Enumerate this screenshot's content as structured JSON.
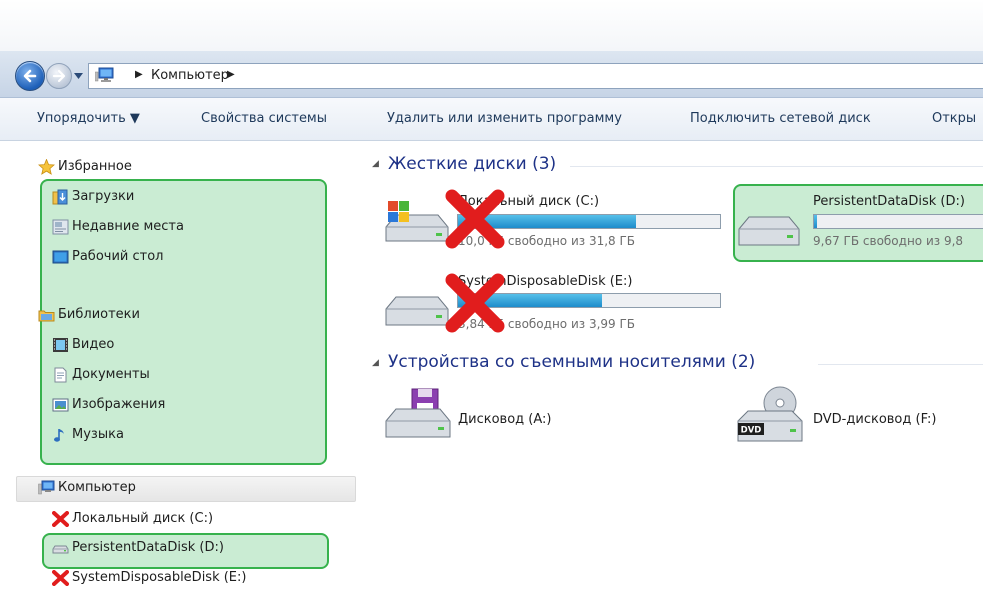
{
  "window": {
    "address": {
      "path": [
        "Компьютер"
      ]
    }
  },
  "toolbar": {
    "organize": "Упорядочить ▼",
    "system_properties": "Свойства системы",
    "uninstall": "Удалить или изменить программу",
    "map_drive": "Подключить сетевой диск",
    "open_control_panel": "Откры"
  },
  "sidebar": {
    "favorites": {
      "label": "Избранное",
      "items": [
        {
          "label": "Загрузки",
          "icon": "downloads-icon"
        },
        {
          "label": "Недавние места",
          "icon": "recent-places-icon"
        },
        {
          "label": "Рабочий стол",
          "icon": "desktop-icon"
        }
      ]
    },
    "libraries": {
      "label": "Библиотеки",
      "items": [
        {
          "label": "Видео",
          "icon": "video-icon"
        },
        {
          "label": "Документы",
          "icon": "documents-icon"
        },
        {
          "label": "Изображения",
          "icon": "images-icon"
        },
        {
          "label": "Музыка",
          "icon": "music-icon"
        }
      ]
    },
    "computer": {
      "label": "Компьютер",
      "items": [
        {
          "label": "Локальный диск (C:)",
          "icon": "drive-icon",
          "crossed": true
        },
        {
          "label": "PersistentDataDisk (D:)",
          "icon": "drive-icon",
          "highlighted": true
        },
        {
          "label": "SystemDisposableDisk (E:)",
          "icon": "drive-icon",
          "crossed": true
        }
      ]
    }
  },
  "content": {
    "hard_disks": {
      "header": "Жесткие диски (3)",
      "drives": [
        {
          "name": "Локальный диск (C:)",
          "free": "10,0 ГБ свободно из 31,8 ГБ",
          "used_fraction": 0.68,
          "crossed": true
        },
        {
          "name": "PersistentDataDisk (D:)",
          "free": "9,67 ГБ свободно из 9,8",
          "used_fraction": 0.02,
          "highlighted": true
        },
        {
          "name": "SystemDisposableDisk (E:)",
          "free": "3,84 ГБ свободно из 3,99 ГБ",
          "used_fraction": 0.55,
          "crossed": true
        }
      ]
    },
    "removable": {
      "header": "Устройства со съемными носителями (2)",
      "devices": [
        {
          "name": "Дисковод (A:)",
          "icon": "floppy-drive-icon"
        },
        {
          "name": "DVD-дисковод (F:)",
          "icon": "dvd-drive-icon",
          "badge": "DVD"
        }
      ]
    }
  },
  "colors": {
    "highlight_border": "#37b24d",
    "highlight_fill": "#a6e2b8",
    "cross": "#e11d1d",
    "capacity_bar": "#2a9ad6"
  }
}
